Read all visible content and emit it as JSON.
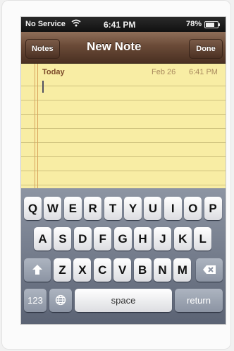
{
  "status_bar": {
    "carrier": "No Service",
    "wifi_icon": "wifi-icon",
    "time": "6:41 PM",
    "battery_text": "78%",
    "battery_level": 0.78
  },
  "nav": {
    "left_button": "Notes",
    "title": "New Note",
    "right_button": "Done"
  },
  "note": {
    "date_label": "Today",
    "month_day": "Feb 26",
    "time": "6:41 PM"
  },
  "keyboard": {
    "row1": [
      "Q",
      "W",
      "E",
      "R",
      "T",
      "Y",
      "U",
      "I",
      "O",
      "P"
    ],
    "row2": [
      "A",
      "S",
      "D",
      "F",
      "G",
      "H",
      "J",
      "K",
      "L"
    ],
    "row3": [
      "Z",
      "X",
      "C",
      "V",
      "B",
      "N",
      "M"
    ],
    "numbers_key": "123",
    "space_key": "space",
    "return_key": "return",
    "shift_icon": "shift-arrow-icon",
    "backspace_icon": "backspace-icon",
    "globe_icon": "globe-icon"
  },
  "colors": {
    "paper": "#f8eda4",
    "nav_brown": "#6a4a37",
    "date_brown": "#7c4b2b"
  }
}
